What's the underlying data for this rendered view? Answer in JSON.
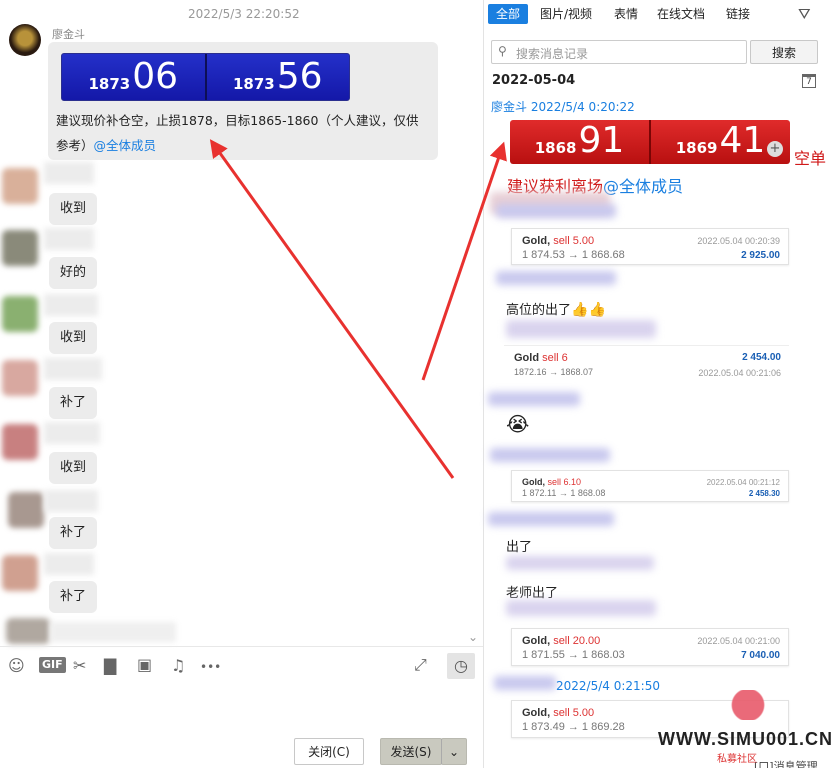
{
  "left": {
    "timestamp": "2022/5/3 22:20:52",
    "sender_name": "廖金斗",
    "quote": {
      "left_small": "1873",
      "left_big": "06",
      "right_small": "1873",
      "right_big": "56"
    },
    "message_line1": "建议现价补仓空，止损1878，目标1865-1860（个人建议，仅供",
    "message_line2": "参考）",
    "mention": "@全体成员",
    "replies": [
      "收到",
      "好的",
      "收到",
      "补了",
      "收到",
      "补了",
      "补了"
    ],
    "collapse_glyph": "⌄",
    "toolbar": {
      "emoji_icon": "☺",
      "gif_label": "GIF",
      "scissors_icon": "✂",
      "folder_icon": "▇",
      "image_icon": "▣",
      "bell_icon": "♫",
      "more_icon": "•••",
      "expand_icon": "⤢",
      "history_icon": "◷"
    },
    "close_button": "关闭(C)",
    "send_button": "发送(S)",
    "send_dropdown": "⌄"
  },
  "right": {
    "tabs": [
      "全部",
      "图片/视频",
      "表情",
      "在线文档",
      "链接"
    ],
    "filter_icon": "⛛",
    "search_placeholder": "搜索消息记录",
    "search_button": "搜索",
    "date_header": "2022-05-04",
    "calendar_icon": "7",
    "first_sender": "廖金斗",
    "first_time": "2022/5/4 0:20:22",
    "red_quote": {
      "left_small": "1868",
      "left_big": "91",
      "right_small": "1869",
      "right_big": "41",
      "plus": "+",
      "tail": "空单"
    },
    "red_message": "建议获利离场",
    "red_mention": "@全体成员",
    "trades": [
      {
        "symbol": "Gold",
        "side": "sell 5.00",
        "path": "1 874.53 → 1 868.68",
        "time": "2022.05.04 00:20:39",
        "amount": "2 925.00"
      },
      {
        "symbol": "Gold",
        "side": "sell 6",
        "path": "1872.16 → 1868.07",
        "time": "2022.05.04 00:21:06",
        "amount": "2 454.00"
      },
      {
        "symbol": "Gold",
        "side": "sell 6.10",
        "path": "1 872.11 → 1 868.08",
        "time": "2022.05.04 00:21:12",
        "amount": "2 458.30"
      },
      {
        "symbol": "Gold",
        "side": "sell 20.00",
        "path": "1 871.55 → 1 868.03",
        "time": "2022.05.04 00:21:00",
        "amount": "7 040.00"
      },
      {
        "symbol": "Gold",
        "side": "sell 5.00",
        "path": "1 873.49 → 1 869.28",
        "time": "",
        "amount": ""
      }
    ],
    "msg_gaowei": "高位的出了",
    "thumbs_emoji": "👍👍",
    "cry_emoji": "😭",
    "msg_chule": "出了",
    "msg_laoshi": "老师出了",
    "late_time": "2022/5/4 0:21:50",
    "bottom_partial": "[口]消息管理"
  },
  "watermark": {
    "url": "WWW.SIMU001.CN",
    "sub": "私募社区"
  },
  "colors": {
    "accent": "#1a7fe0",
    "quote_blue": "#1418a8",
    "quote_red": "#d01a1a",
    "arrow_red": "#e8312f"
  }
}
